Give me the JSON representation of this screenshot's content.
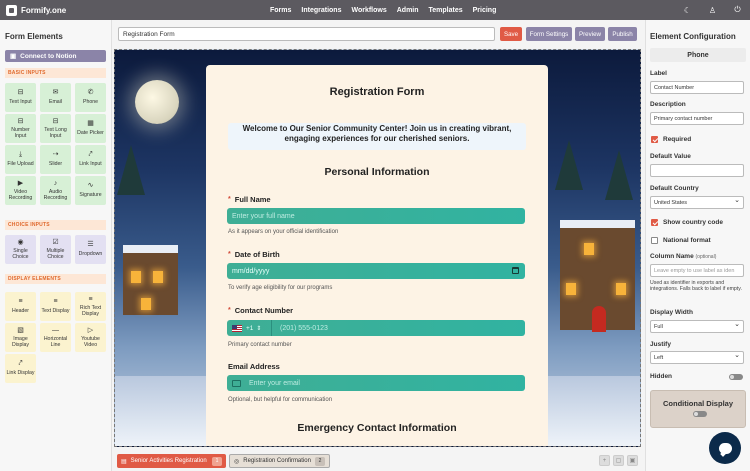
{
  "app": {
    "name": "Formify.one"
  },
  "nav": [
    "Forms",
    "Integrations",
    "Workflows",
    "Admin",
    "Templates",
    "Pricing"
  ],
  "left": {
    "title": "Form Elements",
    "notion": "Connect to Notion",
    "basic_label": "BASIC INPUTS",
    "basic": [
      "Text Input",
      "Email",
      "Phone",
      "Number Input",
      "Text Long Input",
      "Date Picker",
      "File Upload",
      "Slider",
      "Link Input",
      "Video Recording",
      "Audio Recording",
      "Signature"
    ],
    "choice_label": "CHOICE INPUTS",
    "choice": [
      "Single Choice",
      "Multiple Choice",
      "Dropdown"
    ],
    "display_label": "DISPLAY ELEMENTS",
    "display": [
      "Header",
      "Text Display",
      "Rich Text Display",
      "Image Display",
      "Horizontal Line",
      "Youtube Video",
      "Link Display"
    ]
  },
  "toolbar": {
    "title_value": "Registration Form",
    "save": "Save",
    "settings": "Form Settings",
    "preview": "Preview",
    "publish": "Publish"
  },
  "form": {
    "title": "Registration Form",
    "welcome": "Welcome to Our Senior Community Center! Join us in creating vibrant, engaging experiences for our cherished seniors.",
    "section1": "Personal Information",
    "full_name_label": "Full Name",
    "full_name_placeholder": "Enter your full name",
    "full_name_help": "As it appears on your official identification",
    "dob_label": "Date of Birth",
    "dob_placeholder": "mm/dd/yyyy",
    "dob_help": "To verify age eligibility for our programs",
    "contact_label": "Contact Number",
    "phone_code": "+1",
    "phone_placeholder": "(201) 555-0123",
    "contact_help": "Primary contact number",
    "email_label": "Email Address",
    "email_placeholder": "Enter your email",
    "email_help": "Optional, but helpful for communication",
    "section2": "Emergency Contact Information",
    "required_mark": "*"
  },
  "right": {
    "title": "Element Configuration",
    "type": "Phone",
    "label_label": "Label",
    "label_value": "Contact Number",
    "desc_label": "Description",
    "desc_value": "Primary contact number",
    "required": "Required",
    "default_value": "Default Value",
    "default_country": "Default Country",
    "country_value": "United States",
    "show_code": "Show country code",
    "national": "National format",
    "column_name": "Column Name",
    "column_optional": "(optional)",
    "column_placeholder": "Leave empty to use label as iden",
    "column_note": "Used as identifier in exports and integrations. Falls back to label if empty.",
    "display_width": "Display Width",
    "width_value": "Full",
    "justify": "Justify",
    "justify_value": "Left",
    "hidden": "Hidden",
    "conditional": "Conditional Display"
  },
  "pages": [
    {
      "label": "Senior Activities Registration",
      "num": "1"
    },
    {
      "label": "Registration Confirmation",
      "num": "2"
    }
  ],
  "colors": {
    "accent": "#e05a45",
    "purple": "#8b84a8",
    "field": "#3fae95",
    "topbar": "#5c5a60"
  }
}
